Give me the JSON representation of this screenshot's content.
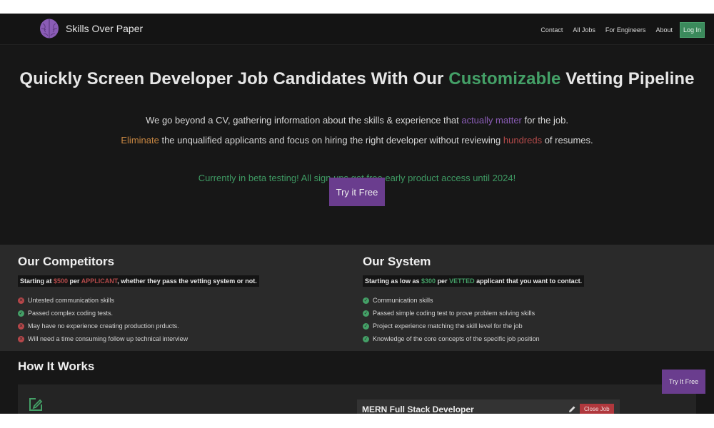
{
  "navbar": {
    "brand_name": "Skills Over Paper",
    "logo_icon": "brain-icon",
    "links": [
      "Contact",
      "All Jobs",
      "For Engineers",
      "About"
    ],
    "login_label": "Log In"
  },
  "hero": {
    "title_before": "Quickly Screen Developer Job Candidates With Our ",
    "title_highlight": "Customizable",
    "title_after": " Vetting Pipeline",
    "line1_before": "We go beyond a CV, gathering information about the skills & experience that ",
    "line1_highlight": "actually matter",
    "line1_after": " for the job.",
    "line2_word1": "Eliminate",
    "line2_middle": " the unqualified applicants and focus on hiring the right developer without reviewing ",
    "line2_word2": "hundreds",
    "line2_after": " of resumes.",
    "beta_text": "Currently in beta testing! All sign ups get free early product access until 2024!",
    "cta_label": "Try it Free"
  },
  "competitors": {
    "heading": "Our Competitors",
    "pricing_before": "Starting at ",
    "pricing_price": "$500",
    "pricing_mid": " per ",
    "pricing_unit": "APPLICANT",
    "pricing_after": ", whether they pass the vetting system or not.",
    "items": [
      {
        "text": "Untested communication skills",
        "status": "x"
      },
      {
        "text": "Passed complex coding tests.",
        "status": "check"
      },
      {
        "text": "May have no experience creating production prducts.",
        "status": "x"
      },
      {
        "text": "Will need a time consuming follow up technical interview",
        "status": "x"
      }
    ]
  },
  "system": {
    "heading": "Our System",
    "pricing_before": "Starting as low as ",
    "pricing_price": "$300",
    "pricing_mid": " per ",
    "pricing_unit": "VETTED",
    "pricing_after": " applicant that you want to contact.",
    "items": [
      {
        "text": "Communication skills",
        "status": "check"
      },
      {
        "text": "Passed simple coding test to prove problem solving skills",
        "status": "check"
      },
      {
        "text": "Project experience matching the skill level for the job",
        "status": "check"
      },
      {
        "text": "Knowledge of the core concepts of the specific job position",
        "status": "check"
      }
    ]
  },
  "how_it_works": {
    "heading": "How It Works",
    "job_title": "MERN Full Stack Developer",
    "close_job_label": "Close Job"
  },
  "floating_cta": {
    "label": "Try It Free"
  },
  "colors": {
    "accent_green": "#44a067",
    "accent_purple": "#6a3d8e",
    "danger_red": "#b0383d"
  }
}
